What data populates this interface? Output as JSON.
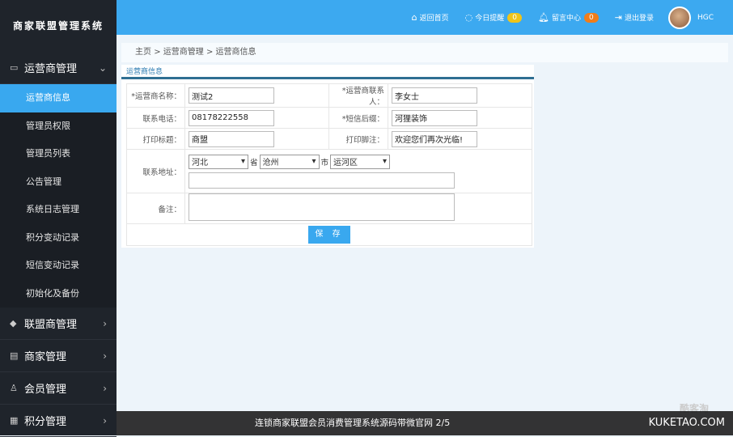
{
  "sidebar": {
    "logo": "商家联盟管理系统",
    "group1": {
      "label": "运营商管理",
      "items": [
        "运营商信息",
        "管理员权限",
        "管理员列表",
        "公告管理",
        "系统日志管理",
        "积分变动记录",
        "短信变动记录",
        "初始化及备份"
      ]
    },
    "groups": [
      "联盟商管理",
      "商家管理",
      "会员管理",
      "积分管理"
    ]
  },
  "topbar": {
    "home": "返回首页",
    "remind": "今日提醒",
    "remind_count": "0",
    "msg": "留言中心",
    "msg_count": "0",
    "logout": "退出登录",
    "user": "HGC"
  },
  "breadcrumb": [
    "主页",
    ">",
    "运营商管理",
    ">",
    "运营商信息"
  ],
  "form": {
    "title": "运营商信息",
    "name_label": "*运营商名称：",
    "name": "测试2",
    "contact_label": "*运营商联系人：",
    "contact": "李女士",
    "phone_label": "联系电话：",
    "phone": "08178222558",
    "sms_label": "*短信后缀：",
    "sms": "河狸装饰",
    "print_title_label": "打印标题：",
    "print_title": "商盟",
    "print_foot_label": "打印脚注：",
    "print_foot": "欢迎您们再次光临!",
    "addr_label": "联系地址：",
    "province": "河北",
    "province_unit": "省",
    "city": "沧州",
    "city_unit": "市",
    "district": "运河区",
    "addr": "",
    "remark_label": "备注：",
    "remark": "",
    "save": "保 存"
  },
  "caption": {
    "text": "连锁商家联盟会员消费管理系统源码带微官网   2/5",
    "site": "KUKETAO.COM",
    "watermark": "酷客淘"
  }
}
